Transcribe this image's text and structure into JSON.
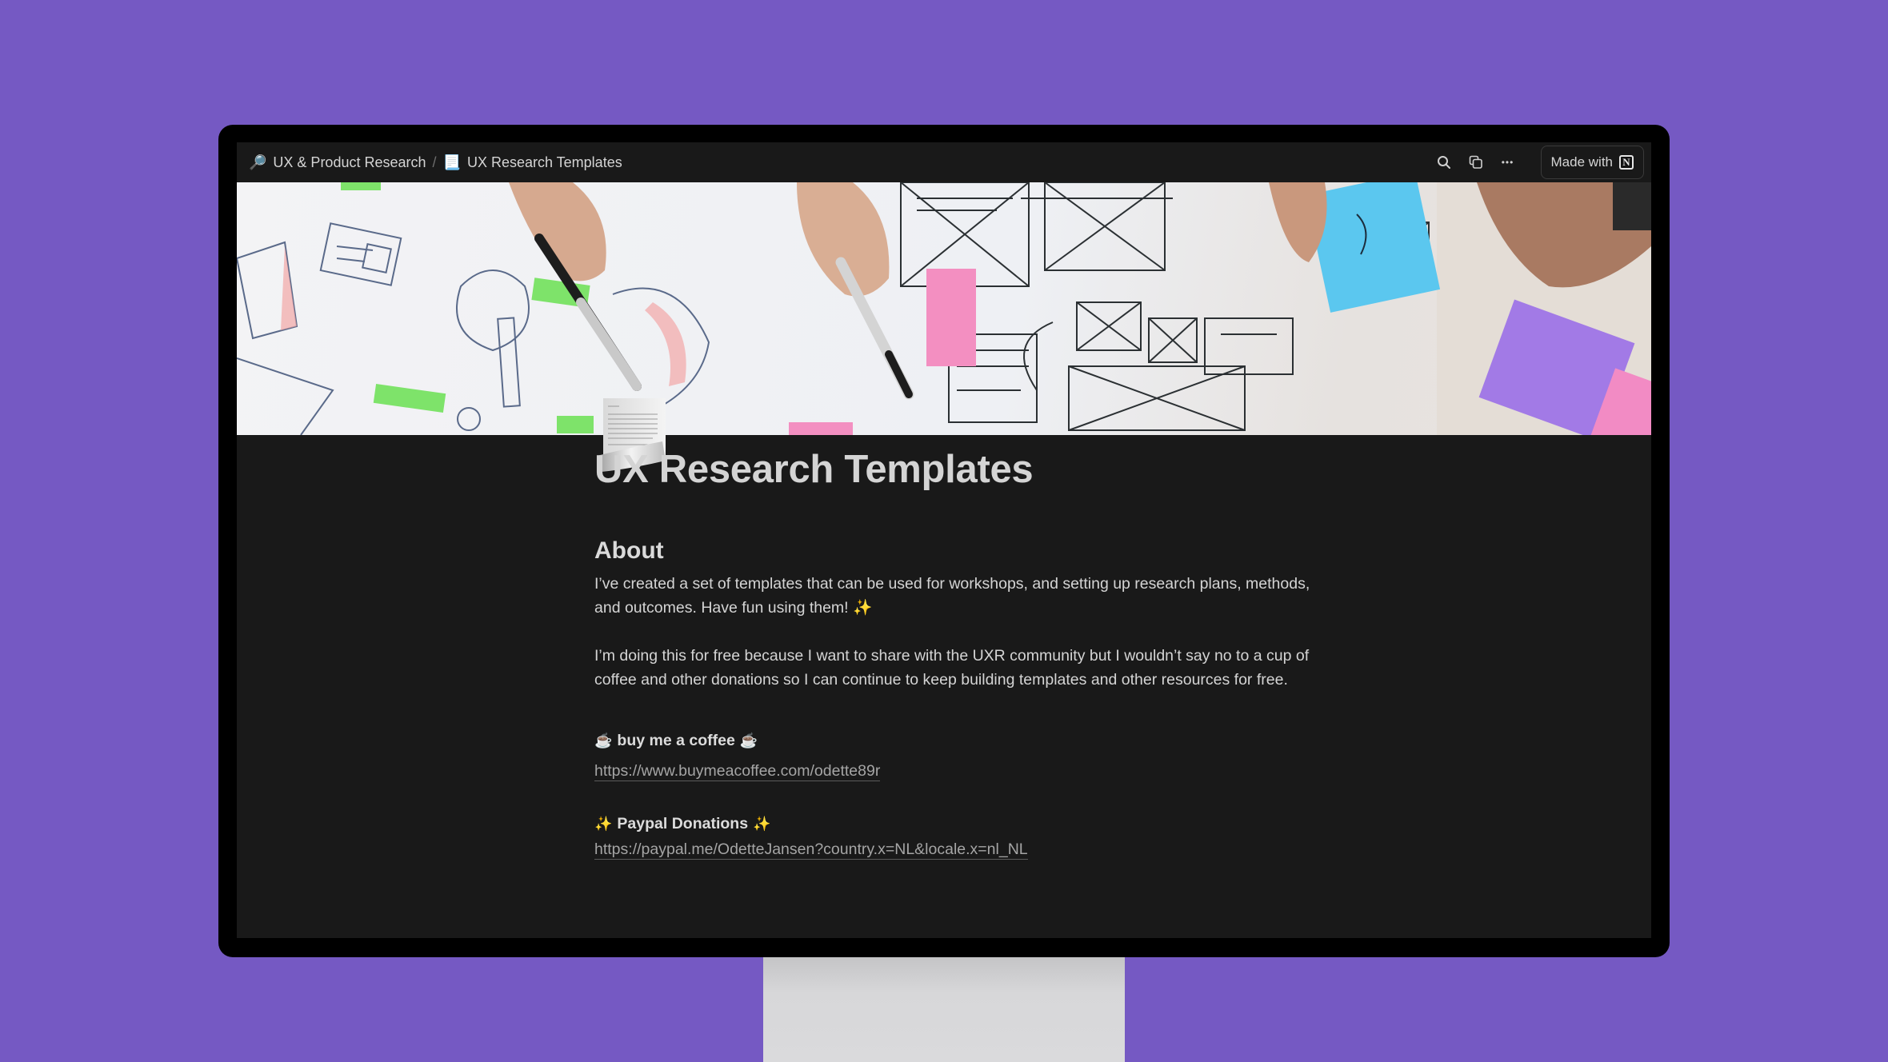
{
  "breadcrumb": {
    "items": [
      {
        "icon": "magnifying-glass-emoji",
        "glyph": "🔎",
        "label": "UX & Product Research"
      },
      {
        "icon": "page-scroll-emoji",
        "glyph": "📃",
        "label": "UX Research Templates"
      }
    ],
    "separator": "/"
  },
  "topbar": {
    "actions": [
      "search-icon",
      "duplicate-icon",
      "more-icon"
    ],
    "more_glyph": "•••",
    "made_with_label": "Made with",
    "notion_glyph": "N"
  },
  "page": {
    "icon_glyph": "📃",
    "title": "UX Research Templates",
    "about_heading": "About",
    "paragraphs": [
      "I’ve created a set of templates that can be used for workshops, and setting up research plans, methods, and outcomes. Have fun using them! ✨",
      "I’m doing this for free because I want to share with the UXR community but I wouldn’t say no to a cup of coffee and other donations so I can continue to keep building templates and other resources for free."
    ],
    "coffee": {
      "emoji": "☕",
      "label": "buy me a coffee",
      "url": "https://www.buymeacoffee.com/odette89r"
    },
    "paypal": {
      "emoji": "✨",
      "label": "Paypal Donations",
      "url": "https://paypal.me/OdetteJansen?country.x=NL&locale.x=nl_NL"
    }
  },
  "colors": {
    "background": "#7559c3",
    "page_bg": "#191919",
    "text": "#d4d4d4",
    "link": "#a5a5a5"
  }
}
